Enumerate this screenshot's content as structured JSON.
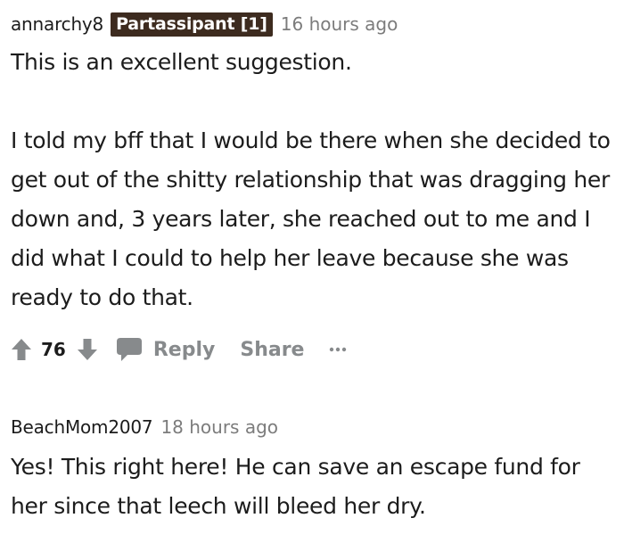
{
  "comments": [
    {
      "username": "annarchy8",
      "flair": "Partassipant [1]",
      "time": "16 hours ago",
      "paragraphs": [
        "This is an excellent suggestion.",
        "I told my bff that I would be there when she decided to get out of the shitty relationship that was dragging her down and, 3 years later, she reached out to me and I did what I could to help her leave because she was ready to do that."
      ],
      "score": "76"
    },
    {
      "username": "BeachMom2007",
      "time": "18 hours ago",
      "paragraphs": [
        "Yes! This right here! He can save an escape fund for her since that leech will bleed her dry."
      ]
    }
  ],
  "actions": {
    "reply_label": "Reply",
    "share_label": "Share",
    "more_label": "•••"
  },
  "icons": {
    "upvote": "upvote-arrow-icon",
    "downvote": "downvote-arrow-icon",
    "reply": "speech-bubble-icon",
    "more": "ellipsis-icon"
  },
  "colors": {
    "flair_background": "#3d2b1f",
    "flair_text": "#ffffff",
    "muted_text": "#878a8c",
    "timestamp": "#7c7c7c",
    "text": "#1c1c1c"
  }
}
